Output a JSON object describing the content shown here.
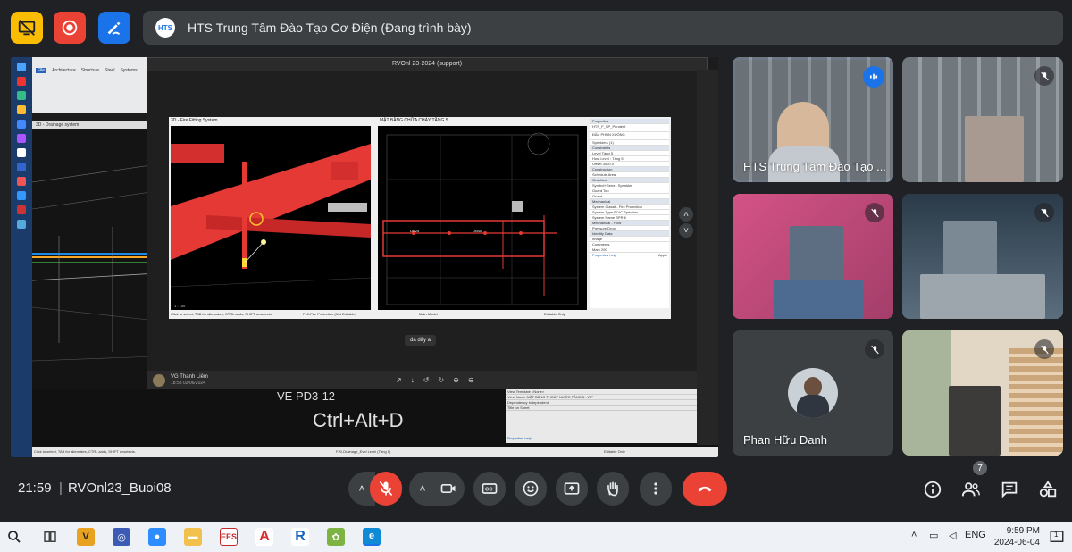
{
  "meet": {
    "presenter_label": "HTS Trung Tâm Đào Tạo Cơ Điện (Đang trình bày)",
    "presenter_logo_text": "HTS",
    "clock": "21:59",
    "separator": "|",
    "meeting_code": "RVOnl23_Buoi08",
    "people_count": "7",
    "colors": {
      "mic_off": "#ea4335",
      "hangup": "#ea4335",
      "accent": "#8ab4f8",
      "speak": "#1a73e8",
      "tile_bg": "#3c4043"
    }
  },
  "presentation": {
    "window_title": "RVOnl 23-2024 (support)",
    "view_3d_tab": "3D - Fire Fitting System",
    "view_plan_tab": "MẶT BẰNG CHỮA CHÁY TẦNG 5",
    "left_view_tab": "3D - Drainage system",
    "ribbon_tabs": [
      "File",
      "Architecture",
      "Structure",
      "Steel",
      "Systems"
    ],
    "properties_title": "Properties",
    "properties_family": "HTS_F_SP_Pendent",
    "properties_type": "ĐẦU PHUN XUỐNG",
    "properties_rows": [
      "Sprinklers (1)",
      "Constraints",
      "Level  Tầng 5",
      "Host  Level : Tầng 5",
      "Offset  3000.0",
      "Construction",
      "Schedule Area",
      "Graphics",
      "Symbol+Gene.. Sprinkler",
      "Guard Top",
      "Guard",
      "Mechanical",
      "System Classif.. Fire Protection",
      "System Type  FLVC Sprinkler",
      "System Name  SPR 6",
      "Mechanical - Flow",
      "Pressure Drop",
      "Identity Data",
      "Image",
      "Comments",
      "Mark  290"
    ],
    "properties_help": "Properties help",
    "apply_label": "Apply",
    "status_text": "Click to select, TAB for alternates, CTRL adds, SHIFT unselects.",
    "status_workset": "F10-Fire Protection (Not Editable)",
    "status_main_model": "Main Model",
    "editable_only": "Editable Only",
    "scale_label": "1 : 100",
    "caption": "da dây a",
    "chat_name": "VG Thanh Liêm",
    "chat_time": "18:53 02/06/2024",
    "shortcut_text": "Ctrl+Alt+D",
    "view_name_label": "VE PD3-12",
    "lower_props": [
      "View Template  <None>",
      "View Name  MẶT BẰNG THOÁT NƯỚC TẦNG 5 - WP",
      "Dependency  Independent",
      "Title on Sheet"
    ],
    "lower_status": "F20-Drainage_Evel Level (Tầng 5)",
    "dim_labels": [
      "DN25",
      "DN40"
    ]
  },
  "participants": [
    {
      "name": "HTS Trung Tâm Đào Tạo ...",
      "speaking": true
    },
    {
      "name": "",
      "muted": true
    },
    {
      "name": "",
      "muted": true
    },
    {
      "name": "",
      "muted": true
    },
    {
      "name": "Phan Hữu Danh",
      "muted": true
    },
    {
      "name": "",
      "muted": true
    }
  ],
  "taskbar": {
    "apps": [
      "search",
      "task-view",
      "vegas",
      "ultraviewer",
      "zoom",
      "file-explorer",
      "ees",
      "acrobat",
      "revit",
      "cc-cleaner",
      "edge"
    ],
    "lang": "ENG",
    "time": "9:59 PM",
    "date": "2024-06-04",
    "notification_count": "1"
  }
}
